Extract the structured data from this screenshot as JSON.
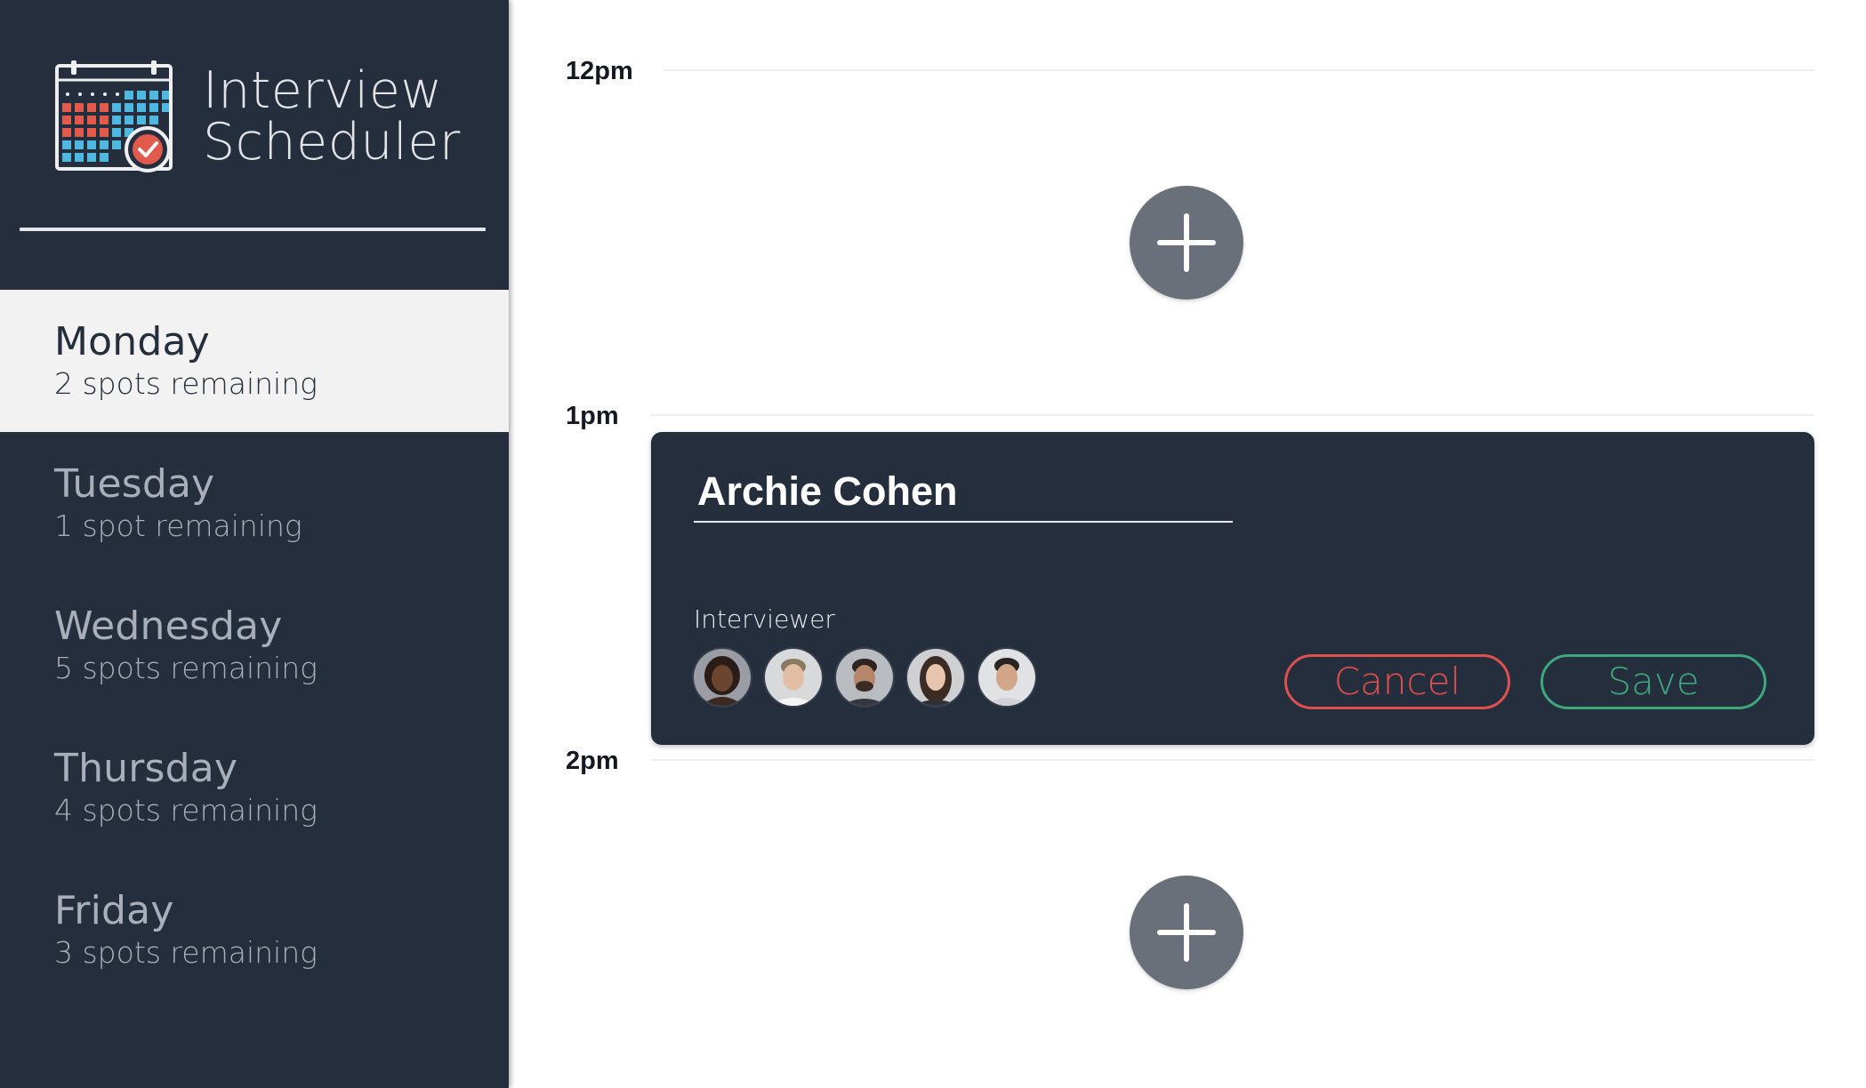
{
  "app": {
    "title_line1": "Interview",
    "title_line2": "Scheduler",
    "logo_icon": "calendar-check-icon"
  },
  "sidebar": {
    "days": [
      {
        "name": "Monday",
        "spots": "2 spots remaining",
        "selected": true
      },
      {
        "name": "Tuesday",
        "spots": "1 spot remaining",
        "selected": false
      },
      {
        "name": "Wednesday",
        "spots": "5 spots remaining",
        "selected": false
      },
      {
        "name": "Thursday",
        "spots": "4 spots remaining",
        "selected": false
      },
      {
        "name": "Friday",
        "spots": "3 spots remaining",
        "selected": false
      }
    ]
  },
  "schedule": {
    "times": [
      "12pm",
      "1pm",
      "2pm"
    ],
    "add_icon": "plus-icon"
  },
  "appointment_form": {
    "student_name": "Archie Cohen",
    "interviewer_label": "Interviewer",
    "interviewer_icons": [
      "avatar",
      "avatar",
      "avatar",
      "avatar",
      "avatar"
    ],
    "cancel_label": "Cancel",
    "save_label": "Save"
  },
  "colors": {
    "sidebar_bg": "#252e3d",
    "selected_day_bg": "#f2f2f2",
    "add_button": "#6a707a",
    "cancel": "#e0504f",
    "save": "#3fa77c"
  }
}
